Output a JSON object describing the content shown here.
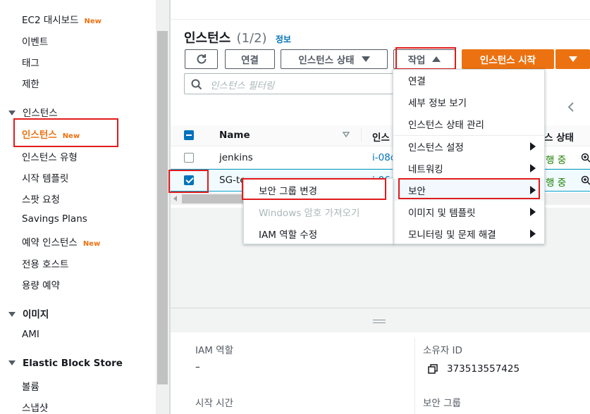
{
  "sidebar": {
    "items": [
      {
        "label": "EC2 대시보드",
        "badge": "New"
      },
      {
        "label": "이벤트"
      },
      {
        "label": "태그"
      },
      {
        "label": "제한"
      }
    ],
    "section_instances": "인스턴스",
    "instances_items": [
      {
        "label": "인스턴스",
        "badge": "New",
        "active": true
      },
      {
        "label": "인스턴스 유형"
      },
      {
        "label": "시작 템플릿"
      },
      {
        "label": "스팟 요청"
      },
      {
        "label": "Savings Plans"
      },
      {
        "label": "예약 인스턴스",
        "badge": "New"
      },
      {
        "label": "전용 호스트"
      },
      {
        "label": "용량 예약"
      }
    ],
    "section_images": "이미지",
    "images_items": [
      {
        "label": "AMI"
      }
    ],
    "section_ebs": "Elastic Block Store",
    "ebs_items": [
      {
        "label": "볼륨"
      },
      {
        "label": "스냅샷"
      }
    ]
  },
  "header": {
    "title": "인스턴스",
    "count": "(1/2)",
    "info_link": "정보"
  },
  "toolbar": {
    "refresh_icon": "refresh-icon",
    "connect_label": "연결",
    "instance_state_label": "인스턴스 상태",
    "actions_label": "작업",
    "launch_label": "인스턴스 시작"
  },
  "search": {
    "placeholder": "인스턴스 필터링"
  },
  "table": {
    "header_name": "Name",
    "header_id": "인스",
    "header_state": "스 상태",
    "rows": [
      {
        "name": "jenkins",
        "id": "i-08c",
        "state": "행 중",
        "checked": false
      },
      {
        "name": "SG-te",
        "id": "i-06",
        "state": "행 중",
        "checked": true
      }
    ]
  },
  "actions_menu": {
    "items": [
      {
        "label": "연결",
        "submenu": false
      },
      {
        "label": "세부 정보 보기",
        "submenu": false
      },
      {
        "label": "인스턴스 상태 관리",
        "submenu": false
      },
      {
        "label": "인스턴스 설정",
        "submenu": true
      },
      {
        "label": "네트워킹",
        "submenu": true
      },
      {
        "label": "보안",
        "submenu": true
      },
      {
        "label": "이미지 및 템플릿",
        "submenu": true
      },
      {
        "label": "모니터링 및 문제 해결",
        "submenu": true
      }
    ]
  },
  "security_submenu": {
    "items": [
      {
        "label": "보안 그룹 변경",
        "disabled": false
      },
      {
        "label": "Windows 암호 가져오기",
        "disabled": true
      },
      {
        "label": "IAM 역할 수정",
        "disabled": false
      }
    ]
  },
  "details": {
    "iam_role_label": "IAM 역할",
    "iam_role_value": "–",
    "owner_id_label": "소유자 ID",
    "owner_id_value": "373513557425",
    "launch_time_label": "시작 시간",
    "security_group_label": "보안 그룹"
  },
  "colors": {
    "accent": "#ec7211",
    "link": "#0073bb",
    "highlight": "#e11b1b",
    "running": "#1d8102"
  }
}
